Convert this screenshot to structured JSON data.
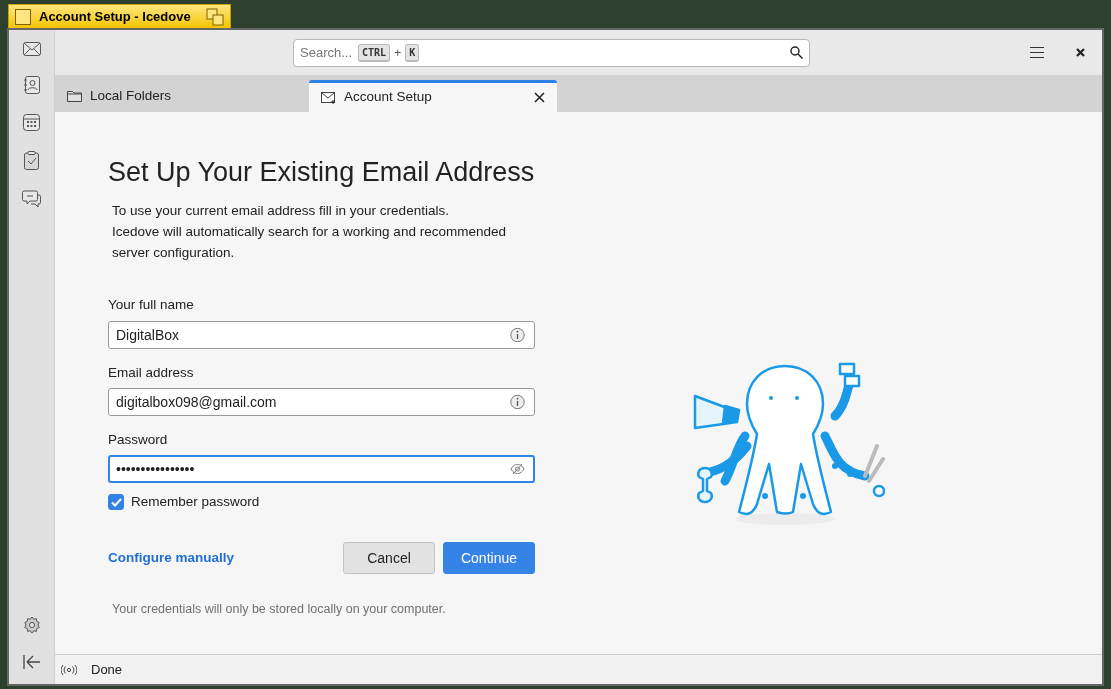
{
  "window": {
    "title": "Account Setup - Icedove"
  },
  "search": {
    "placeholder": "Search...",
    "shortcut_keys": [
      "CTRL",
      "K"
    ],
    "shortcut_joiner": "+"
  },
  "tabs": [
    {
      "label": "Local Folders",
      "kind": "folder",
      "selected": false
    },
    {
      "label": "Account Setup",
      "kind": "mail",
      "selected": true
    }
  ],
  "page": {
    "heading": "Set Up Your Existing Email Address",
    "intro": [
      "To use your current email address fill in your credentials.",
      "Icedove will automatically search for a working and recommended server configuration."
    ],
    "fields": [
      {
        "label": "Your full name",
        "value": "DigitalBox",
        "kind": "text",
        "focused": false
      },
      {
        "label": "Email address",
        "value": "digitalbox098@gmail.com",
        "kind": "text",
        "focused": false
      },
      {
        "label": "Password",
        "value": "••••••••••••••••",
        "kind": "password",
        "focused": true
      }
    ],
    "remember_password": {
      "label": "Remember password",
      "checked": true
    },
    "configure_link": "Configure manually",
    "buttons": [
      {
        "label": "Cancel",
        "kind": "secondary"
      },
      {
        "label": "Continue",
        "kind": "primary"
      }
    ],
    "note": "Your credentials will only be stored locally on your computer."
  },
  "status_bar": {
    "text": "Done"
  }
}
